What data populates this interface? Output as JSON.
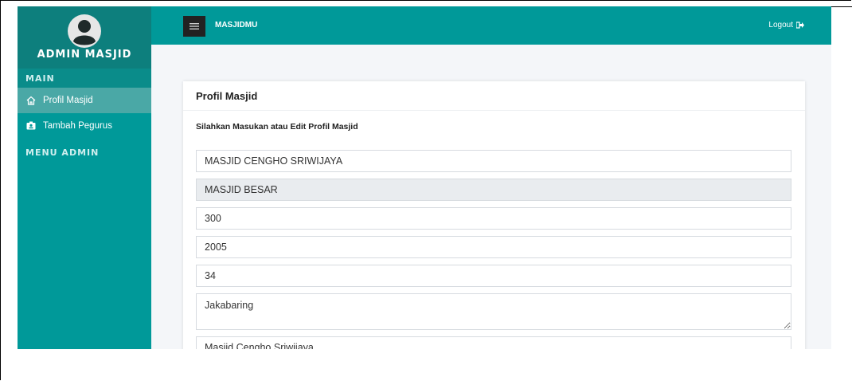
{
  "sidebar": {
    "brand": "ADMIN MASJID",
    "section_main": "MAIN",
    "items": [
      {
        "label": "Profil Masjid",
        "icon": "home-icon",
        "active": true
      },
      {
        "label": "Tambah Pegurus",
        "icon": "user-card-icon",
        "active": false
      }
    ],
    "section_admin": "MENU ADMIN"
  },
  "topbar": {
    "title": "MASJIDMU",
    "logout_label": "Logout"
  },
  "card": {
    "title": "Profil Masjid",
    "subtitle": "Silahkan Masukan atau Edit Profil Masjid",
    "fields": [
      {
        "value": "MASJID CENGHO SRIWIJAYA"
      },
      {
        "value": "MASJID BESAR"
      },
      {
        "value": "300"
      },
      {
        "value": "2005"
      },
      {
        "value": "34"
      },
      {
        "value": "Jakabaring"
      },
      {
        "value": "Masjid Cengho Sriwijaya"
      }
    ]
  },
  "colors": {
    "primary": "#009999",
    "sidebar_header": "#0d7f7d",
    "active_item": "#4aa8a6"
  }
}
